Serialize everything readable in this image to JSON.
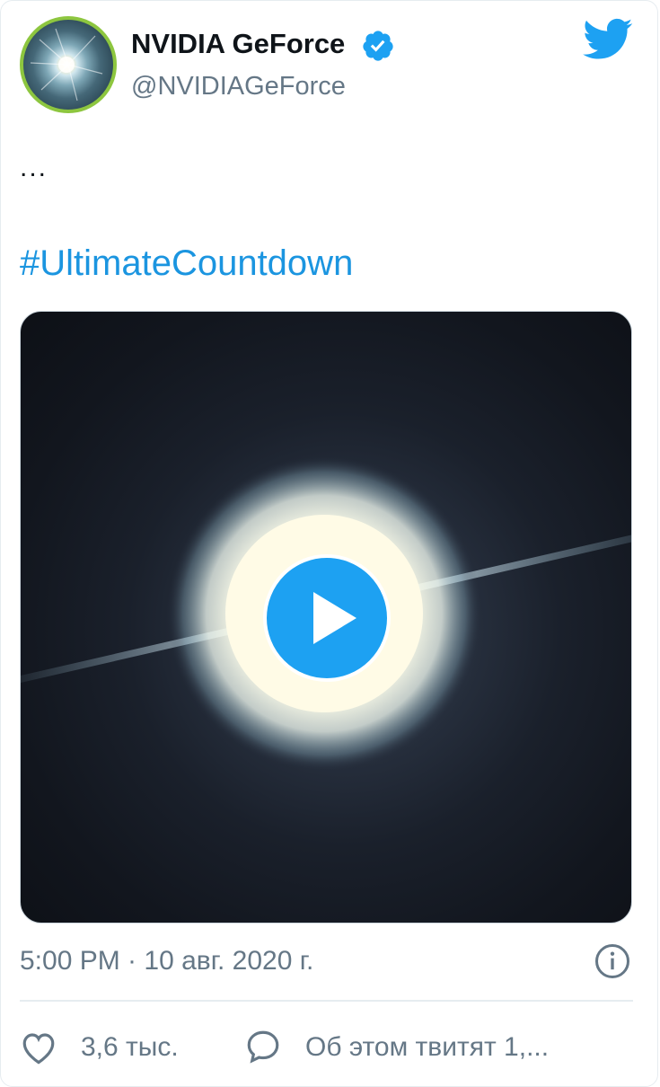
{
  "tweet": {
    "author": {
      "display_name": "NVIDIA GeForce",
      "handle": "@NVIDIAGeForce",
      "verified": true,
      "avatar_icon": "nvidia-geforce-avatar"
    },
    "platform_icon": "twitter-bird-icon",
    "text_line": "...",
    "hashtag": "#UltimateCountdown",
    "media": {
      "type": "video",
      "play_icon": "play-icon"
    },
    "timestamp": "5:00 PM · 10 авг. 2020 г.",
    "actions": {
      "like_count": "3,6 тыс.",
      "reply_text": "Об этом твитят 1,..."
    }
  },
  "colors": {
    "brand_blue": "#1da1f2",
    "link_blue": "#1b95e0",
    "secondary_text": "#657786",
    "avatar_ring": "#8dc63f"
  }
}
